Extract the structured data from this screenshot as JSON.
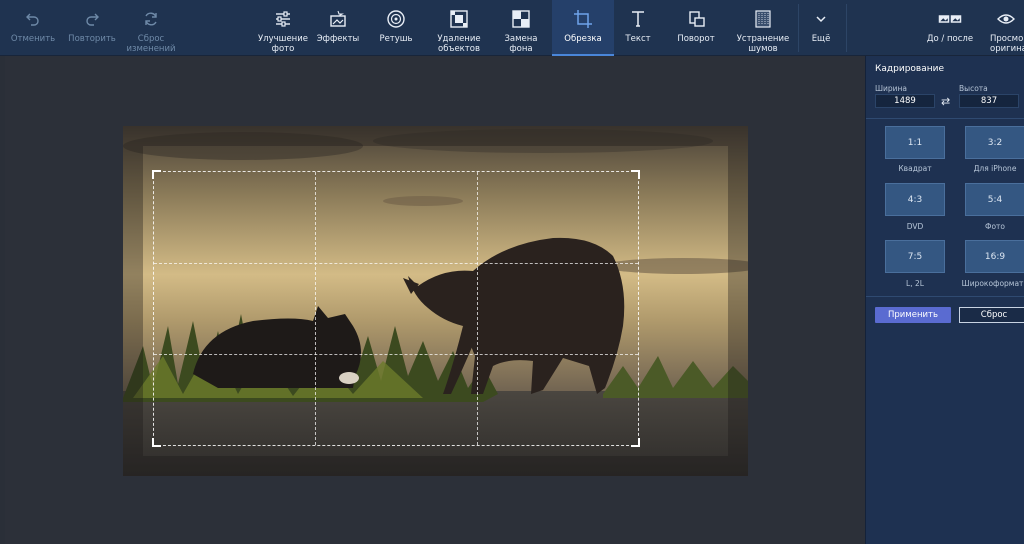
{
  "toolbar": {
    "undo": "Отменить",
    "redo": "Повторить",
    "reset_changes": "Сброс\nизменений",
    "enhance": "Улучшение\nфото",
    "effects": "Эффекты",
    "retouch": "Ретушь",
    "remove_objects": "Удаление\nобъектов",
    "replace_bg": "Замена\nфона",
    "crop": "Обрезка",
    "text": "Текст",
    "rotate": "Поворот",
    "denoise": "Устранение\nшумов",
    "more": "Ещё",
    "before_after": "До / после",
    "preview": "Просмо\nоригина"
  },
  "panel": {
    "title": "Кадрирование",
    "width_label": "Ширина",
    "height_label": "Высота",
    "width_value": "1489",
    "height_value": "837",
    "ratios": [
      {
        "ratio": "1:1",
        "label": "Квадрат"
      },
      {
        "ratio": "3:2",
        "label": "Для iPhone"
      },
      {
        "ratio": "4:3",
        "label": "DVD"
      },
      {
        "ratio": "5:4",
        "label": "Фото"
      },
      {
        "ratio": "7:5",
        "label": "L, 2L"
      },
      {
        "ratio": "16:9",
        "label": "Широкоформатн"
      }
    ],
    "apply": "Применить",
    "reset": "Сброс"
  },
  "colors": {
    "toolbar_bg": "#1f3350",
    "panel_bg": "#1e3151",
    "canvas_bg": "#2c3039",
    "accent": "#5a6bd1"
  }
}
